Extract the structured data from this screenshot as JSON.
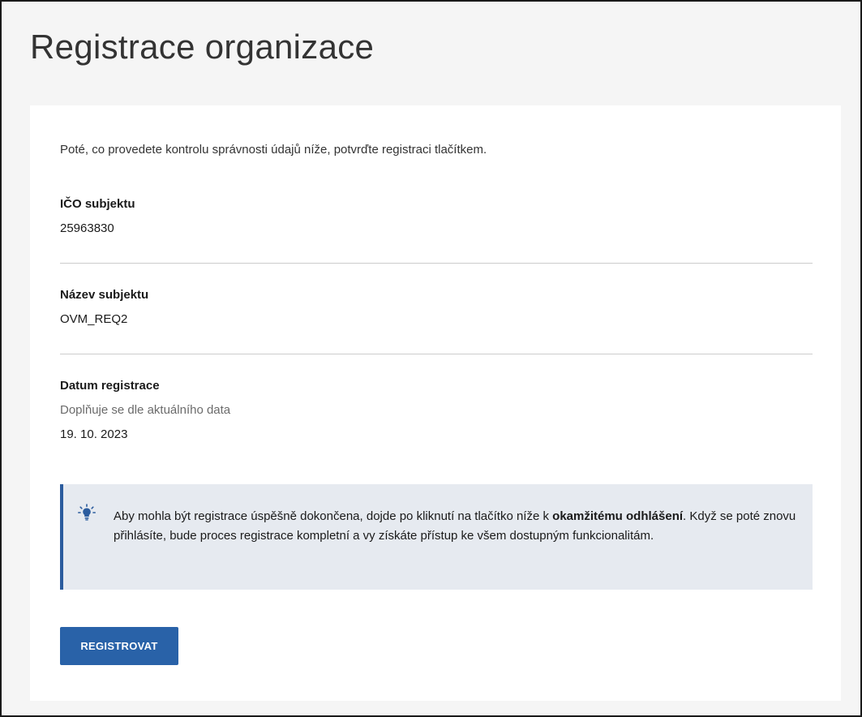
{
  "page": {
    "title": "Registrace organizace"
  },
  "form": {
    "intro": "Poté, co provedete kontrolu správnosti údajů níže, potvrďte registraci tlačítkem.",
    "fields": [
      {
        "label": "IČO subjektu",
        "value": "25963830"
      },
      {
        "label": "Název subjektu",
        "value": "OVM_REQ2"
      },
      {
        "label": "Datum registrace",
        "hint": "Doplňuje se dle aktuálního data",
        "value": "19. 10. 2023"
      }
    ]
  },
  "notice": {
    "icon": "lightbulb-icon",
    "text_before": "Aby mohla být registrace úspěšně dokončena, dojde po kliknutí na tlačítko níže k ",
    "text_bold": "okamžitému odhlášení",
    "text_after": ". Když se poté znovu přihlásíte, bude proces registrace kompletní a vy získáte přístup ke všem dostupným funkcionalitám."
  },
  "actions": {
    "register_label": "REGISTROVAT"
  },
  "colors": {
    "primary": "#2962a8",
    "notice_bg": "#e6eaf0",
    "notice_border": "#2b5c9e",
    "icon_accent": "#2b5c9e"
  }
}
